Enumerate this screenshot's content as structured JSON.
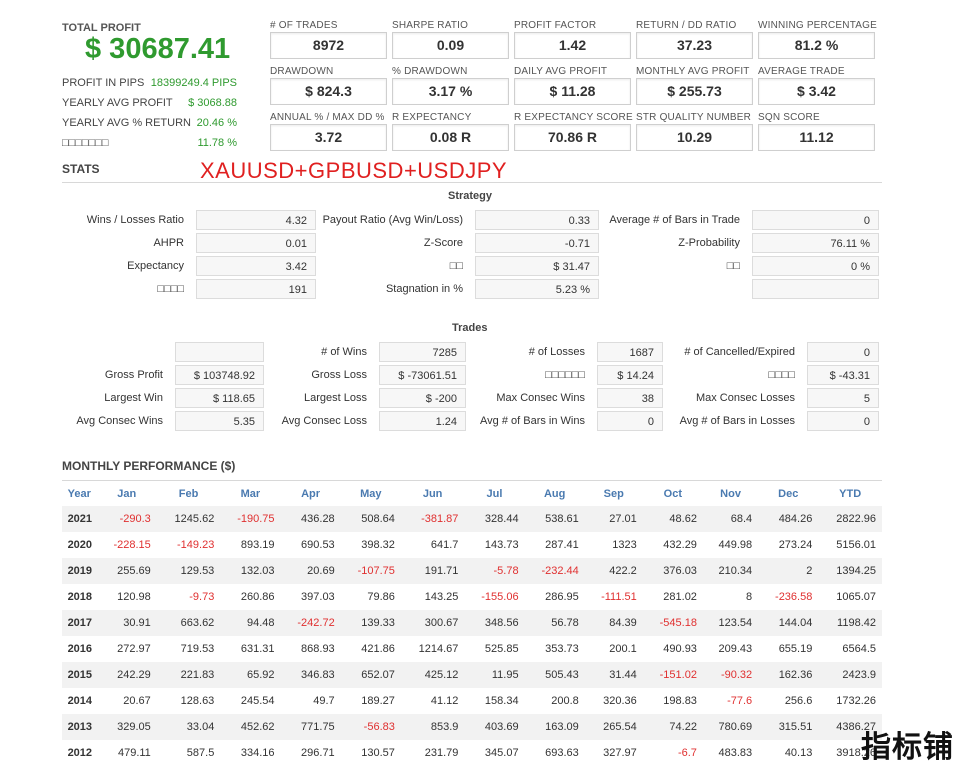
{
  "summary": {
    "total_profit_label": "TOTAL PROFIT",
    "total_profit_value": "$ 30687.41",
    "rows": [
      {
        "label": "PROFIT IN PIPS",
        "value": "18399249.4 PIPS"
      },
      {
        "label": "YEARLY AVG PROFIT",
        "value": "$ 3068.88"
      },
      {
        "label": "YEARLY AVG % RETURN",
        "value": "20.46 %"
      },
      {
        "label": "□□□□□□□",
        "value": "11.78 %"
      }
    ]
  },
  "grid": [
    {
      "label": "# OF TRADES",
      "value": "8972"
    },
    {
      "label": "SHARPE RATIO",
      "value": "0.09"
    },
    {
      "label": "PROFIT FACTOR",
      "value": "1.42"
    },
    {
      "label": "RETURN / DD RATIO",
      "value": "37.23"
    },
    {
      "label": "WINNING PERCENTAGE",
      "value": "81.2 %"
    },
    {
      "label": "DRAWDOWN",
      "value": "$ 824.3"
    },
    {
      "label": "% DRAWDOWN",
      "value": "3.17 %"
    },
    {
      "label": "DAILY AVG PROFIT",
      "value": "$ 11.28"
    },
    {
      "label": "MONTHLY AVG PROFIT",
      "value": "$ 255.73"
    },
    {
      "label": "AVERAGE TRADE",
      "value": "$ 3.42"
    },
    {
      "label": "ANNUAL % / MAX DD %",
      "value": "3.72"
    },
    {
      "label": "R EXPECTANCY",
      "value": "0.08 R"
    },
    {
      "label": "R EXPECTANCY SCORE",
      "value": "70.86 R"
    },
    {
      "label": "STR QUALITY NUMBER",
      "value": "10.29"
    },
    {
      "label": "SQN SCORE",
      "value": "11.12"
    }
  ],
  "stats_title": "STATS",
  "annotation": "XAUUSD+GPBUSD+USDJPY",
  "strategy": {
    "title": "Strategy",
    "cells": [
      {
        "label": "Wins / Losses Ratio",
        "value": "4.32"
      },
      {
        "label": "Payout Ratio (Avg Win/Loss)",
        "value": "0.33"
      },
      {
        "label": "Average # of Bars in Trade",
        "value": "0"
      },
      {
        "label": "AHPR",
        "value": "0.01"
      },
      {
        "label": "Z-Score",
        "value": "-0.71"
      },
      {
        "label": "Z-Probability",
        "value": "76.11 %"
      },
      {
        "label": "Expectancy",
        "value": "3.42"
      },
      {
        "label": "□□",
        "value": "$ 31.47"
      },
      {
        "label": "□□",
        "value": "0 %"
      },
      {
        "label": "□□□□",
        "value": "191"
      },
      {
        "label": "Stagnation in %",
        "value": "5.23 %"
      },
      {
        "label": "",
        "value": ""
      }
    ]
  },
  "trades": {
    "title": "Trades",
    "cells": [
      {
        "label": "",
        "value": ""
      },
      {
        "label": "# of Wins",
        "value": "7285"
      },
      {
        "label": "# of Losses",
        "value": "1687"
      },
      {
        "label": "# of Cancelled/Expired",
        "value": "0"
      },
      {
        "label": "Gross Profit",
        "value": "$ 103748.92"
      },
      {
        "label": "Gross Loss",
        "value": "$ -73061.51"
      },
      {
        "label": "□□□□□□",
        "value": "$ 14.24"
      },
      {
        "label": "□□□□",
        "value": "$ -43.31"
      },
      {
        "label": "Largest Win",
        "value": "$ 118.65"
      },
      {
        "label": "Largest Loss",
        "value": "$ -200"
      },
      {
        "label": "Max Consec Wins",
        "value": "38"
      },
      {
        "label": "Max Consec Losses",
        "value": "5"
      },
      {
        "label": "Avg Consec Wins",
        "value": "5.35"
      },
      {
        "label": "Avg Consec Loss",
        "value": "1.24"
      },
      {
        "label": "Avg # of Bars in Wins",
        "value": "0"
      },
      {
        "label": "Avg # of Bars in Losses",
        "value": "0"
      }
    ]
  },
  "monthly": {
    "title": "MONTHLY PERFORMANCE ($)",
    "headers": [
      "Year",
      "Jan",
      "Feb",
      "Mar",
      "Apr",
      "May",
      "Jun",
      "Jul",
      "Aug",
      "Sep",
      "Oct",
      "Nov",
      "Dec",
      "YTD"
    ],
    "rows": [
      [
        "2021",
        "-290.3",
        "1245.62",
        "-190.75",
        "436.28",
        "508.64",
        "-381.87",
        "328.44",
        "538.61",
        "27.01",
        "48.62",
        "68.4",
        "484.26",
        "2822.96"
      ],
      [
        "2020",
        "-228.15",
        "-149.23",
        "893.19",
        "690.53",
        "398.32",
        "641.7",
        "143.73",
        "287.41",
        "1323",
        "432.29",
        "449.98",
        "273.24",
        "5156.01"
      ],
      [
        "2019",
        "255.69",
        "129.53",
        "132.03",
        "20.69",
        "-107.75",
        "191.71",
        "-5.78",
        "-232.44",
        "422.2",
        "376.03",
        "210.34",
        "2",
        "1394.25"
      ],
      [
        "2018",
        "120.98",
        "-9.73",
        "260.86",
        "397.03",
        "79.86",
        "143.25",
        "-155.06",
        "286.95",
        "-111.51",
        "281.02",
        "8",
        "-236.58",
        "1065.07"
      ],
      [
        "2017",
        "30.91",
        "663.62",
        "94.48",
        "-242.72",
        "139.33",
        "300.67",
        "348.56",
        "56.78",
        "84.39",
        "-545.18",
        "123.54",
        "144.04",
        "1198.42"
      ],
      [
        "2016",
        "272.97",
        "719.53",
        "631.31",
        "868.93",
        "421.86",
        "1214.67",
        "525.85",
        "353.73",
        "200.1",
        "490.93",
        "209.43",
        "655.19",
        "6564.5"
      ],
      [
        "2015",
        "242.29",
        "221.83",
        "65.92",
        "346.83",
        "652.07",
        "425.12",
        "11.95",
        "505.43",
        "31.44",
        "-151.02",
        "-90.32",
        "162.36",
        "2423.9"
      ],
      [
        "2014",
        "20.67",
        "128.63",
        "245.54",
        "49.7",
        "189.27",
        "41.12",
        "158.34",
        "200.8",
        "320.36",
        "198.83",
        "-77.6",
        "256.6",
        "1732.26"
      ],
      [
        "2013",
        "329.05",
        "33.04",
        "452.62",
        "771.75",
        "-56.83",
        "853.9",
        "403.69",
        "163.09",
        "265.54",
        "74.22",
        "780.69",
        "315.51",
        "4386.27"
      ],
      [
        "2012",
        "479.11",
        "587.5",
        "334.16",
        "296.71",
        "130.57",
        "231.79",
        "345.07",
        "693.63",
        "327.97",
        "-6.7",
        "483.83",
        "40.13",
        "3918.26"
      ]
    ]
  },
  "watermark": "指标铺",
  "colors": {
    "positive": "#2f9a2f",
    "negative": "#e03030",
    "header_blue": "#4a7ab0",
    "annotation_red": "#e02020"
  }
}
